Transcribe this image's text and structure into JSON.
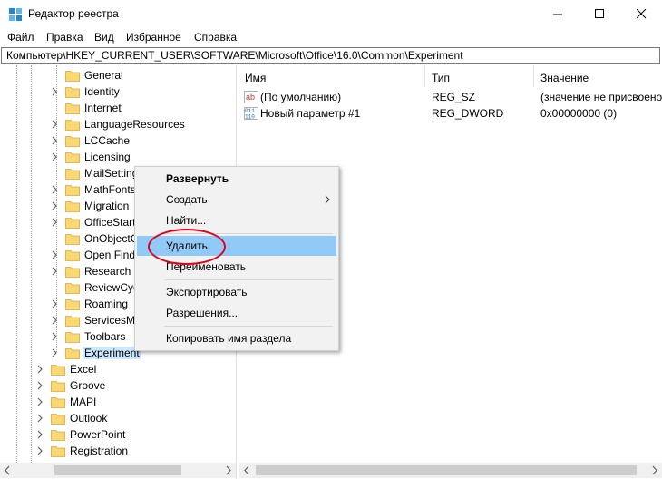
{
  "window": {
    "title": "Редактор реестра"
  },
  "menu": [
    "Файл",
    "Правка",
    "Вид",
    "Избранное",
    "Справка"
  ],
  "address": "Компьютер\\HKEY_CURRENT_USER\\SOFTWARE\\Microsoft\\Office\\16.0\\Common\\Experiment",
  "tree": {
    "items": [
      {
        "label": "General",
        "level": 2,
        "expandable": false
      },
      {
        "label": "Identity",
        "level": 2,
        "expandable": true
      },
      {
        "label": "Internet",
        "level": 2,
        "expandable": false
      },
      {
        "label": "LanguageResources",
        "level": 2,
        "expandable": true
      },
      {
        "label": "LCCache",
        "level": 2,
        "expandable": true
      },
      {
        "label": "Licensing",
        "level": 2,
        "expandable": true
      },
      {
        "label": "MailSettings",
        "level": 2,
        "expandable": false
      },
      {
        "label": "MathFonts",
        "level": 2,
        "expandable": true
      },
      {
        "label": "Migration",
        "level": 2,
        "expandable": true
      },
      {
        "label": "OfficeStart",
        "level": 2,
        "expandable": true
      },
      {
        "label": "OnObjectC",
        "level": 2,
        "expandable": false
      },
      {
        "label": "Open Find",
        "level": 2,
        "expandable": true
      },
      {
        "label": "Research",
        "level": 2,
        "expandable": true
      },
      {
        "label": "ReviewCyc",
        "level": 2,
        "expandable": false
      },
      {
        "label": "Roaming",
        "level": 2,
        "expandable": true
      },
      {
        "label": "ServicesMa",
        "level": 2,
        "expandable": true
      },
      {
        "label": "Toolbars",
        "level": 2,
        "expandable": true
      },
      {
        "label": "Experiment",
        "level": 2,
        "expandable": true,
        "selected": true
      },
      {
        "label": "Excel",
        "level": 1,
        "expandable": true
      },
      {
        "label": "Groove",
        "level": 1,
        "expandable": true
      },
      {
        "label": "MAPI",
        "level": 1,
        "expandable": true
      },
      {
        "label": "Outlook",
        "level": 1,
        "expandable": true
      },
      {
        "label": "PowerPoint",
        "level": 1,
        "expandable": true
      },
      {
        "label": "Registration",
        "level": 1,
        "expandable": true
      }
    ]
  },
  "list": {
    "columns": [
      "Имя",
      "Тип",
      "Значение"
    ],
    "rows": [
      {
        "icon": "string-value-icon",
        "name": "(По умолчанию)",
        "type": "REG_SZ",
        "value": "(значение не присвоено)"
      },
      {
        "icon": "binary-value-icon",
        "name": "Новый параметр #1",
        "type": "REG_DWORD",
        "value": "0x00000000 (0)"
      }
    ]
  },
  "context_menu": {
    "items": [
      {
        "label": "Развернуть",
        "bold": true
      },
      {
        "label": "Создать",
        "submenu": true
      },
      {
        "label": "Найти..."
      },
      {
        "separator": true
      },
      {
        "label": "Удалить",
        "highlighted": true
      },
      {
        "label": "Переименовать"
      },
      {
        "separator": true
      },
      {
        "label": "Экспортировать"
      },
      {
        "label": "Разрешения..."
      },
      {
        "separator": true
      },
      {
        "label": "Копировать имя раздела"
      }
    ]
  },
  "colors": {
    "selection": "#cce8ff",
    "menu_highlight": "#91c9f7",
    "annotation_ring": "#e4001b",
    "folder": "#f8d775"
  }
}
